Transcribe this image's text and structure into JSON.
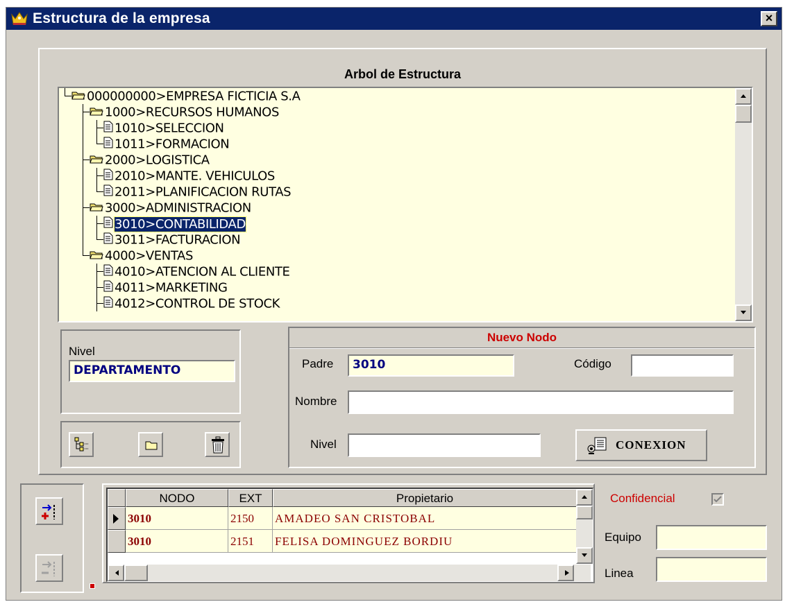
{
  "window": {
    "title": "Estructura de la empresa",
    "close_glyph": "×",
    "icon": "crown-icon"
  },
  "tree": {
    "header": "Arbol de Estructura",
    "nodes": [
      {
        "label": "000000000>EMPRESA FICTICIA S.A",
        "type": "folder"
      },
      {
        "label": "1000>RECURSOS HUMANOS",
        "type": "folder"
      },
      {
        "label": "1010>SELECCION",
        "type": "document"
      },
      {
        "label": "1011>FORMACION",
        "type": "document"
      },
      {
        "label": "2000>LOGISTICA",
        "type": "folder"
      },
      {
        "label": "2010>MANTE. VEHICULOS",
        "type": "document"
      },
      {
        "label": "2011>PLANIFICACION RUTAS",
        "type": "document"
      },
      {
        "label": "3000>ADMINISTRACION",
        "type": "folder"
      },
      {
        "label": "3010>CONTABILIDAD",
        "type": "document",
        "selected": true
      },
      {
        "label": "3011>FACTURACION",
        "type": "document"
      },
      {
        "label": "4000>VENTAS",
        "type": "folder"
      },
      {
        "label": "4010>ATENCION AL CLIENTE",
        "type": "document"
      },
      {
        "label": "4011>MARKETING",
        "type": "document"
      },
      {
        "label": "4012>CONTROL DE STOCK",
        "type": "document"
      }
    ]
  },
  "nivel": {
    "label": "Nivel",
    "value": "DEPARTAMENTO"
  },
  "tree_buttons": {
    "expand_icon": "tree-expand-icon",
    "folder_icon": "folder-icon",
    "delete_icon": "trash-icon"
  },
  "nuevo_nodo": {
    "title": "Nuevo Nodo",
    "padre_label": "Padre",
    "padre_value": "3010",
    "codigo_label": "Código",
    "codigo_value": "",
    "nombre_label": "Nombre",
    "nombre_value": "",
    "nivel_label": "Nivel",
    "nivel_value": "",
    "conexion_label": "CONEXION"
  },
  "grid": {
    "columns": [
      "NODO",
      "EXT",
      "Propietario"
    ],
    "rows": [
      {
        "nodo": "3010",
        "ext": "2150",
        "propietario": "AMADEO SAN CRISTOBAL",
        "current": true
      },
      {
        "nodo": "3010",
        "ext": "2151",
        "propietario": "FELISA DOMINGUEZ BORDIU",
        "current": false
      }
    ]
  },
  "side": {
    "confidencial_label": "Confidencial",
    "confidencial_checked": true,
    "equipo_label": "Equipo",
    "equipo_value": "",
    "linea_label": "Linea",
    "linea_value": ""
  },
  "colors": {
    "window_bg": "#d4d0c8",
    "field_bg": "#ffffe1",
    "title_bar": "#0a246a",
    "accent_red": "#cc0000",
    "data_red": "#8b0000",
    "nivel_blue": "#000080"
  }
}
